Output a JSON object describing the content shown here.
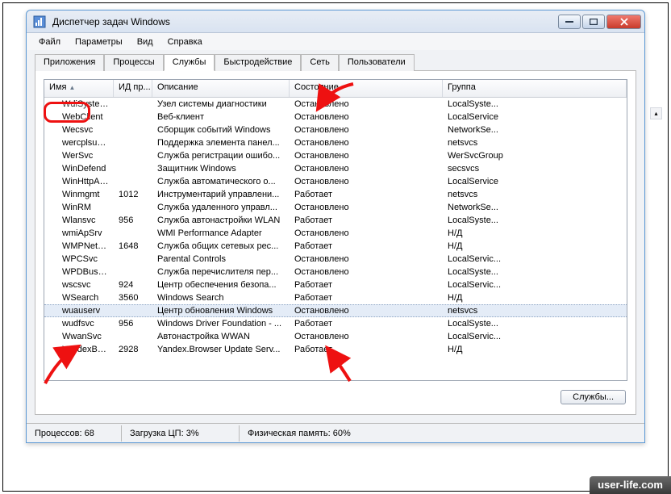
{
  "window": {
    "title": "Диспетчер задач Windows"
  },
  "menu": {
    "file": "Файл",
    "options": "Параметры",
    "view": "Вид",
    "help": "Справка"
  },
  "tabs": {
    "apps": "Приложения",
    "processes": "Процессы",
    "services": "Службы",
    "performance": "Быстродействие",
    "network": "Сеть",
    "users": "Пользователи"
  },
  "columns": {
    "name": "Имя",
    "pid": "ИД пр...",
    "desc": "Описание",
    "state": "Состояние",
    "group": "Группа"
  },
  "sort_glyph": "▲",
  "states": {
    "running": "Работает",
    "stopped": "Остановлено"
  },
  "rows": [
    {
      "name": "WdiSystem...",
      "pid": "",
      "desc": "Узел системы диагностики",
      "state": "Остановлено",
      "group": "LocalSyste..."
    },
    {
      "name": "WebClient",
      "pid": "",
      "desc": "Веб-клиент",
      "state": "Остановлено",
      "group": "LocalService"
    },
    {
      "name": "Wecsvc",
      "pid": "",
      "desc": "Сборщик событий Windows",
      "state": "Остановлено",
      "group": "NetworkSe..."
    },
    {
      "name": "wercplsupport",
      "pid": "",
      "desc": "Поддержка элемента панел...",
      "state": "Остановлено",
      "group": "netsvcs"
    },
    {
      "name": "WerSvc",
      "pid": "",
      "desc": "Служба регистрации ошибо...",
      "state": "Остановлено",
      "group": "WerSvcGroup"
    },
    {
      "name": "WinDefend",
      "pid": "",
      "desc": "Защитник Windows",
      "state": "Остановлено",
      "group": "secsvcs"
    },
    {
      "name": "WinHttpAut...",
      "pid": "",
      "desc": "Служба автоматического о...",
      "state": "Остановлено",
      "group": "LocalService"
    },
    {
      "name": "Winmgmt",
      "pid": "1012",
      "desc": "Инструментарий управлени...",
      "state": "Работает",
      "group": "netsvcs"
    },
    {
      "name": "WinRM",
      "pid": "",
      "desc": "Служба удаленного управл...",
      "state": "Остановлено",
      "group": "NetworkSe..."
    },
    {
      "name": "Wlansvc",
      "pid": "956",
      "desc": "Служба автонастройки WLAN",
      "state": "Работает",
      "group": "LocalSyste..."
    },
    {
      "name": "wmiApSrv",
      "pid": "",
      "desc": "WMI Performance Adapter",
      "state": "Остановлено",
      "group": "Н/Д"
    },
    {
      "name": "WMPNetwo...",
      "pid": "1648",
      "desc": "Служба общих сетевых рес...",
      "state": "Работает",
      "group": "Н/Д"
    },
    {
      "name": "WPCSvc",
      "pid": "",
      "desc": "Parental Controls",
      "state": "Остановлено",
      "group": "LocalServic..."
    },
    {
      "name": "WPDBusEnum",
      "pid": "",
      "desc": "Служба перечислителя пер...",
      "state": "Остановлено",
      "group": "LocalSyste..."
    },
    {
      "name": "wscsvc",
      "pid": "924",
      "desc": "Центр обеспечения безопа...",
      "state": "Работает",
      "group": "LocalServic..."
    },
    {
      "name": "WSearch",
      "pid": "3560",
      "desc": "Windows Search",
      "state": "Работает",
      "group": "Н/Д"
    },
    {
      "name": "wuauserv",
      "pid": "",
      "desc": "Центр обновления Windows",
      "state": "Остановлено",
      "group": "netsvcs",
      "selected": true
    },
    {
      "name": "wudfsvc",
      "pid": "956",
      "desc": "Windows Driver Foundation - ...",
      "state": "Работает",
      "group": "LocalSyste..."
    },
    {
      "name": "WwanSvc",
      "pid": "",
      "desc": "Автонастройка WWAN",
      "state": "Остановлено",
      "group": "LocalServic..."
    },
    {
      "name": "YandexBro...",
      "pid": "2928",
      "desc": "Yandex.Browser Update Serv...",
      "state": "Работает",
      "group": "Н/Д"
    }
  ],
  "buttons": {
    "services": "Службы..."
  },
  "status": {
    "processes": "Процессов: 68",
    "cpu": "Загрузка ЦП: 3%",
    "mem": "Физическая память: 60%"
  },
  "watermark": "user-life.com"
}
